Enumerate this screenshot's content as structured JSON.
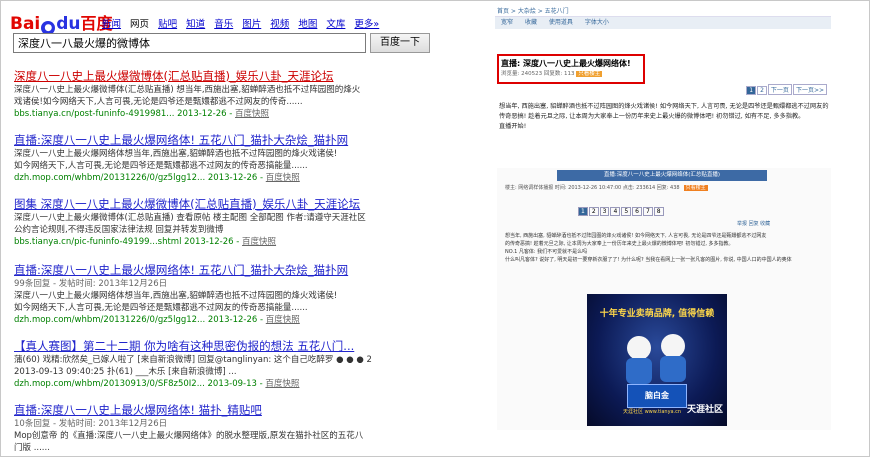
{
  "baidu": {
    "logo": {
      "text1": "Bai",
      "text2": "du",
      "text_cn": "百度"
    },
    "nav": [
      "新闻",
      "网页",
      "贴吧",
      "知道",
      "音乐",
      "图片",
      "视频",
      "地图",
      "文库",
      "更多»"
    ],
    "nav_active": "网页",
    "query": "深度八一八最火爆的微博体",
    "search_button": "百度一下",
    "results": [
      {
        "title": "深度八一八史上最火爆微博体(汇总贴直播)_娱乐八卦_天涯论坛",
        "summary1": "深度八一八史上最火爆微博体(汇总贴直播) 想当年,西施出塞,貂蝉醉酒也抵不过阵园图的烽火",
        "summary2": "戏诸侯!如今网络天下,人言可畏,无论是四爷还是甄嬛都逃不过网友的传奇......",
        "url": "bbs.tianya.cn/post-funinfo-4919981...",
        "date": "2013-12-26",
        "cache": "百度快照"
      },
      {
        "title": "直播:深度八一八史上最火爆网络体! 五花八门_猫扑大杂烩_猫扑网",
        "summary1": "深度八一八史上最火爆网络体想当年,西施出塞,貂蝉醉酒也抵不过阵园图的烽火戏诸侯!",
        "summary2": "如今网络天下,人言可畏,无论是四爷还是甄嬛都逃不过网友的传奇恶搞能量......",
        "url": "dzh.mop.com/whbm/20131226/0/gz5lgg12...",
        "date": "2013-12-26",
        "cache": "百度快照"
      },
      {
        "title": "图集 深度八一八史上最火爆微博体(汇总贴直播)_娱乐八卦_天涯论坛",
        "summary1": "深度八一八史上最火爆微博体(汇总贴直播) 查看原帖 楼主配图 全部配图 作者:请遵守天涯社区",
        "summary2": "公约言论规则,不得违反国家法律法规 回复并转发到微博",
        "url": "bbs.tianya.cn/pic-funinfo-49199...shtml",
        "date": "2013-12-26",
        "cache": "百度快照"
      },
      {
        "title": "直播:深度八一八史上最火爆网络体! 五花八门_猫扑大杂烩_猫扑网",
        "meta": "99条回复 - 发帖时间: 2013年12月26日",
        "summary1": "深度八一八史上最火爆网络体想当年,西施出塞,貂蝉醉酒也抵不过阵园图的烽火戏诸侯!",
        "summary2": "如今网络天下,人言可畏,无论是四爷还是甄嬛都逃不过网友的传奇恶搞能量......",
        "url": "dzh.mop.com/whbm/20131226/0/gz5lgg12...",
        "date": "2013-12-26",
        "cache": "百度快照"
      },
      {
        "title": "【真人赛图】第二十二期 你为啥有这种思密伪报的想法 五花八门...",
        "summary1": "蒲(60) 戏精:欣然矣_已嫁人啦了 [来自新浪微博] 回复@tanglinyan: 这个自己吃醉罗 ● ● ● 2",
        "summary2": "2013-09-13 09:40:25 扑(61) ___木乐 [来自新浪微博] ...",
        "url": "dzh.mop.com/whbm/20130913/0/SF8z50I2...",
        "date": "2013-09-13",
        "cache": "百度快照"
      },
      {
        "title": "直播:深度八一八史上最火爆网络体! 猫扑_精贴吧",
        "meta": "10条回复 - 发帖时间: 2013年12月26日",
        "summary1": "Mop创意帝 的《直播:深度八一八史上最火爆网络体》的脱水整理版,原发在猫扑社区的五花八",
        "summary2": "门版 ......",
        "url": "",
        "date": "",
        "cache": ""
      }
    ]
  },
  "forum": {
    "breadcrumb": "首页  >  大杂烩  >  五花八门",
    "tabs": [
      "宽窄",
      "收藏",
      "使用道具",
      "字体大小"
    ],
    "post_title": "直播: 深度八一八史上最火爆网络体!",
    "post_meta": "浏览量: 240523  回复数: 113",
    "post_badge": "只看楼主",
    "pager": [
      "1",
      "2",
      "下一页",
      "下一页>>"
    ],
    "pager_current": "1",
    "body": "想当年, 西施出塞, 貂蝉醉酒也抵不过阵园图的烽火戏诸侯! 如今网络天下, 人言可畏, 无论是四爷还是甄嬛都逃不过网友的传奇恶搞! 趁着元旦之际, 让本周为大家奉上一份历年来史上最火爆的微博体吧! 初勿错过, 如有不足, 多多指教。",
    "body_end": "直播开始!"
  },
  "screenshot2": {
    "header": "直播:深度八一八史上最火爆网络体(汇总贴直播)",
    "info": "楼主: 网络调样体播报  时间: 2013-12-26 10:47:00  点击: 233614  回复: 438",
    "info_btn": "只看楼主",
    "pages": [
      "1",
      "2",
      "3",
      "4",
      "5",
      "6",
      "7",
      "8"
    ],
    "page_current": "1",
    "tabs": "举报  回复  收藏",
    "text1": "想当年, 西施出塞, 貂蝉醉酒也抵不过阵园图的烽火戏诸侯! 如今网络天下, 人言可畏, 无论是四爷还是甄嬛都逃不过网友",
    "text2": "的传奇恶搞! 趁着元旦之际, 让本周为大家奉上一份历年来史上最火爆的微博体吧! 初勿错过, 多多指教。",
    "text3": "NO.1 凡客体: 我们不可爱就不是么吗",
    "text4": "什么叫凡客体? 说好了, 明天是初一要穿新衣服了了! 为什么呢? 当我在看网上一张一张凡客的图片, 你说, 中国人口的中国人的奥体",
    "ad": {
      "slogan": "十年专业卖萌品牌, 值得信赖",
      "brand": "脑白金",
      "tianya": "天涯社区",
      "sub": "天涯社区 www.tianya.cn"
    }
  }
}
